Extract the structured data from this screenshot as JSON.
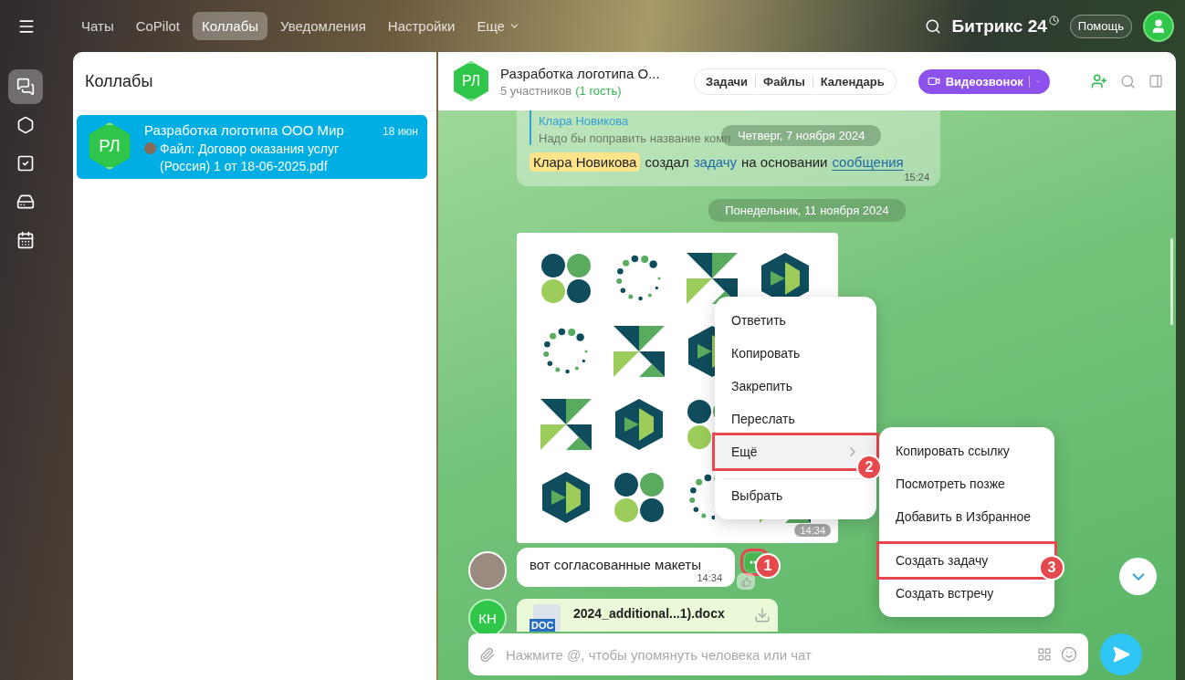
{
  "top_nav": {
    "tabs": [
      {
        "label": "Чаты",
        "selected": false,
        "kind": "plain"
      },
      {
        "label": "CoPilot",
        "selected": false,
        "kind": "plain"
      },
      {
        "label": "Коллабы",
        "selected": true,
        "kind": "plain"
      },
      {
        "label": "Уведомления",
        "selected": false,
        "kind": "plain"
      },
      {
        "label": "Настройки",
        "selected": false,
        "kind": "plain"
      },
      {
        "label": "Еще",
        "selected": false,
        "kind": "dropdown"
      }
    ],
    "brand": "Битрикс 24",
    "help": "Помощь"
  },
  "rail": {
    "items": [
      {
        "kind": "chats",
        "selected": true
      },
      {
        "kind": "collabs",
        "selected": false
      },
      {
        "kind": "tasks",
        "selected": false
      },
      {
        "kind": "drive",
        "selected": false
      },
      {
        "kind": "calendar",
        "selected": false
      }
    ]
  },
  "collabs_panel": {
    "title": "Коллабы",
    "items": [
      {
        "initials": "РЛ",
        "title": "Разработка логотипа ООО Мир",
        "date": "18 июн",
        "preview": "Файл: Договор оказания услуг (Россия) 1 от 18-06-2025.pdf",
        "selected": true
      }
    ]
  },
  "chat": {
    "header": {
      "initials": "РЛ",
      "title": "Разработка логотипа О...",
      "members": "5 участников",
      "guests": "(1 гость)",
      "tabs": [
        "Задачи",
        "Файлы",
        "Календарь"
      ],
      "video_call": "Видеозвонок"
    },
    "sticky_date": "Четверг, 7 ноября 2024",
    "messages": [
      {
        "kind": "system",
        "quote_author": "Клара Новикова",
        "quote_text": "Надо бы поправить название комп",
        "mention": "Клара Новикова",
        "text_before": "создал",
        "link1": "задачу",
        "text_mid": "на основании",
        "link2": "сообщения",
        "time": "15:24"
      },
      {
        "kind": "date",
        "text": "Понедельник, 11 ноября 2024"
      },
      {
        "kind": "image",
        "time": "14:34"
      },
      {
        "kind": "text",
        "text": "вот согласованные макеты",
        "time": "14:34",
        "more_highlighted": true
      },
      {
        "kind": "file",
        "initials": "КН",
        "file_name": "2024_additional...1).docx",
        "file_type": "DOC"
      }
    ],
    "input_placeholder": "Нажмите @, чтобы упомянуть человека или чат"
  },
  "context_menu": {
    "items": [
      {
        "label": "Ответить",
        "kind": "action",
        "hovered": false,
        "separated": false,
        "highlighted": false
      },
      {
        "label": "Копировать",
        "kind": "action",
        "hovered": false,
        "separated": false,
        "highlighted": false
      },
      {
        "label": "Закрепить",
        "kind": "action",
        "hovered": false,
        "separated": false,
        "highlighted": false
      },
      {
        "label": "Переслать",
        "kind": "action",
        "hovered": false,
        "separated": false,
        "highlighted": false
      },
      {
        "label": "Ещё",
        "kind": "submenu",
        "hovered": true,
        "separated": false,
        "highlighted": true
      },
      {
        "label": "Выбрать",
        "kind": "action",
        "hovered": false,
        "separated": true,
        "highlighted": false
      }
    ]
  },
  "submenu": {
    "items": [
      {
        "label": "Копировать ссылку",
        "kind": "action",
        "hovered": false,
        "separated": false,
        "highlighted": false
      },
      {
        "label": "Посмотреть позже",
        "kind": "action",
        "hovered": false,
        "separated": false,
        "highlighted": false
      },
      {
        "label": "Добавить в Избранное",
        "kind": "action",
        "hovered": false,
        "separated": false,
        "highlighted": false
      },
      {
        "label": "Создать задачу",
        "kind": "action",
        "hovered": false,
        "separated": true,
        "highlighted": true
      },
      {
        "label": "Создать встречу",
        "kind": "action",
        "hovered": false,
        "separated": false,
        "highlighted": false
      }
    ]
  },
  "annotations": [
    {
      "number": "1"
    },
    {
      "number": "2"
    },
    {
      "number": "3"
    }
  ]
}
